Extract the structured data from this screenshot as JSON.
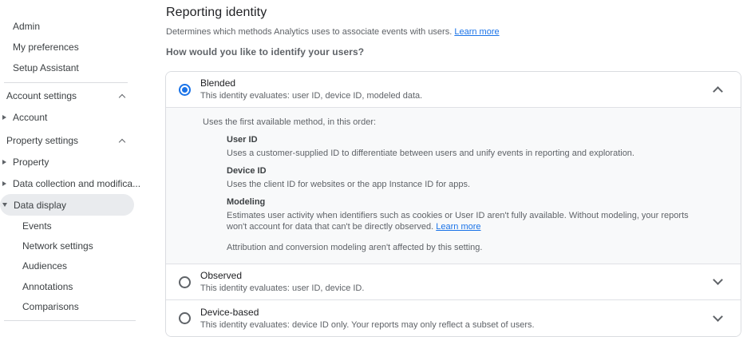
{
  "sidebar": {
    "items_top": [
      "Admin",
      "My preferences",
      "Setup Assistant"
    ],
    "sections": [
      {
        "header": "Account settings",
        "items": [
          {
            "label": "Account"
          }
        ]
      },
      {
        "header": "Property settings",
        "items": [
          {
            "label": "Property"
          },
          {
            "label": "Data collection and modifica..."
          },
          {
            "label": "Data display",
            "children": [
              "Events",
              "Network settings",
              "Audiences",
              "Annotations",
              "Comparisons"
            ]
          }
        ]
      }
    ]
  },
  "main": {
    "title": "Reporting identity",
    "subtitle": "Determines which methods Analytics uses to associate events with users.",
    "subtitle_link": "Learn more",
    "question": "How would you like to identify your users?",
    "options": [
      {
        "name": "Blended",
        "description": "This identity evaluates: user ID, device ID, modeled data.",
        "selected": true,
        "expanded": true,
        "details": {
          "intro": "Uses the first available method, in this order:",
          "methods": [
            {
              "name": "User ID",
              "description": "Uses a customer-supplied ID to differentiate between users and unify events in reporting and exploration."
            },
            {
              "name": "Device ID",
              "description": "Uses the client ID for websites or the app Instance ID for apps."
            },
            {
              "name": "Modeling",
              "description": "Estimates user activity when identifiers such as cookies or User ID aren't fully available. Without modeling, your reports won't account for data that can't be directly observed.",
              "link": "Learn more"
            }
          ],
          "note": "Attribution and conversion modeling aren't affected by this setting."
        }
      },
      {
        "name": "Observed",
        "description": "This identity evaluates: user ID, device ID.",
        "selected": false,
        "expanded": false
      },
      {
        "name": "Device-based",
        "description": "This identity evaluates: device ID only. Your reports may only reflect a subset of users.",
        "selected": false,
        "expanded": false
      }
    ]
  },
  "colors": {
    "accent_blue": "#1a73e8",
    "panel_gray": "#f8f9fa",
    "border_gray": "#dadce0",
    "text_primary": "#202124",
    "text_secondary": "#5f6368"
  }
}
